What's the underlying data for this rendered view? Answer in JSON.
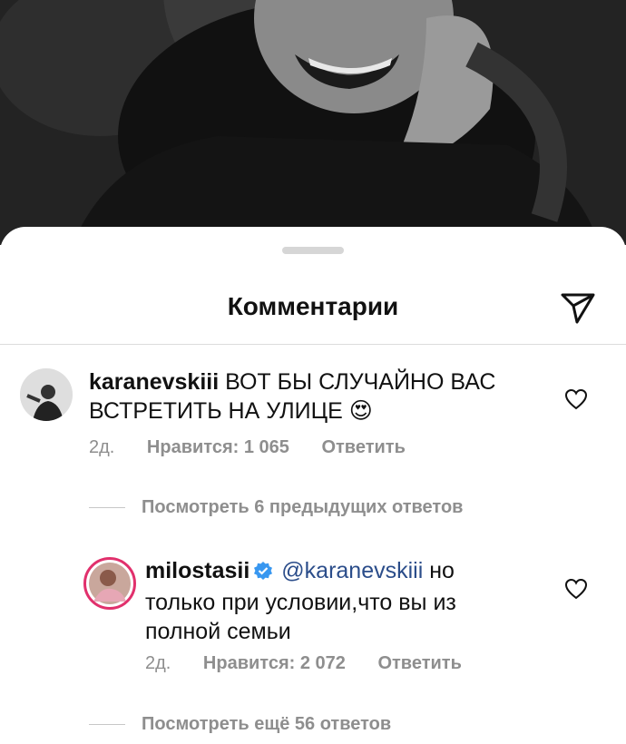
{
  "sheet": {
    "title": "Комментарии"
  },
  "comments": [
    {
      "username": "karanevskiii",
      "text": "ВОТ БЫ СЛУЧАЙНО ВАС ВСТРЕТИТЬ НА УЛИЦЕ",
      "emoji": "😍",
      "time": "2д.",
      "likes": "Нравится: 1 065",
      "reply": "Ответить"
    },
    {
      "username": "milostasii",
      "mention": "@karanevskiii",
      "text_line1": " но",
      "text_line2": "только при условии,что вы из",
      "text_line3": "полной семьи",
      "time": "2д.",
      "likes": "Нравится: 2 072",
      "reply": "Ответить"
    }
  ],
  "view_previous": "Посмотреть 6 предыдущих ответов",
  "view_more": "Посмотреть ещё 56 ответов",
  "colors": {
    "verified": "#3897f0",
    "story_ring": "#e1306c",
    "meta_gray": "#8e8e8e"
  }
}
